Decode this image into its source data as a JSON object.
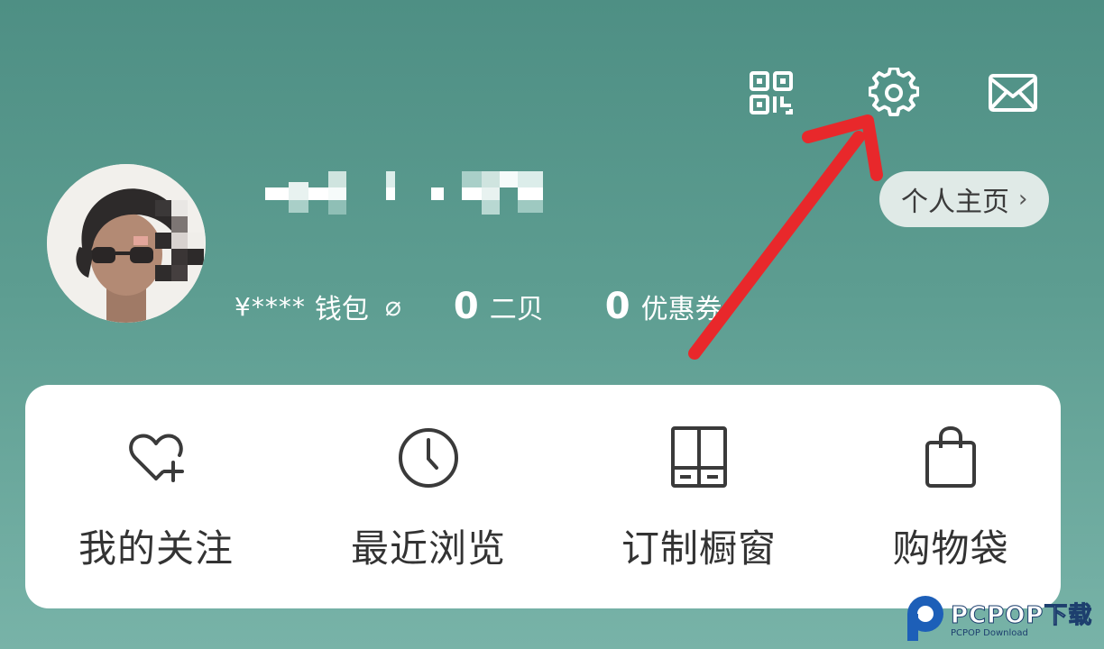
{
  "header": {
    "icons": [
      {
        "name": "qr-code-icon"
      },
      {
        "name": "gear-icon"
      },
      {
        "name": "mail-icon"
      }
    ]
  },
  "profile": {
    "username_pixelated": true,
    "home_link": "个人主页",
    "home_chevron": "›"
  },
  "stats": {
    "wallet_amount": "¥****",
    "wallet_label": "钱包",
    "eye_icon": "⌀",
    "pages_value": "0",
    "pages_label": "二贝",
    "coupons_value": "0",
    "coupons_label": "优惠券"
  },
  "menu": {
    "items": [
      {
        "label": "我的关注",
        "icon": "heart-plus-icon"
      },
      {
        "label": "最近浏览",
        "icon": "clock-icon"
      },
      {
        "label": "订制橱窗",
        "icon": "cabinet-icon"
      },
      {
        "label": "购物袋",
        "icon": "shopping-bag-icon"
      }
    ]
  },
  "annotation": {
    "arrow_color": "#e8282b",
    "points_to": "gear-icon"
  },
  "watermark": {
    "main": "PCPOP下载",
    "sub": "PCPOP Download"
  },
  "colors": {
    "background_top": "#4e8f84",
    "background_bottom": "#78b3a8",
    "card": "#ffffff",
    "text_dark": "#333333"
  }
}
